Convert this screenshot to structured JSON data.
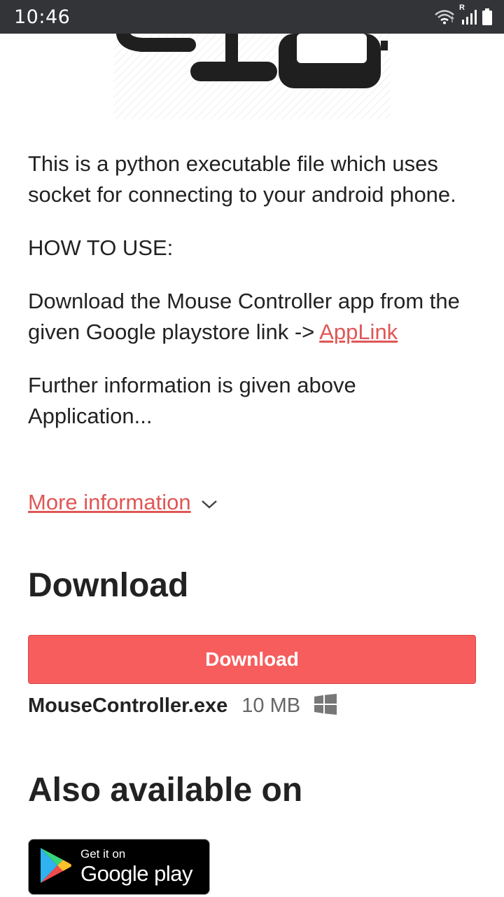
{
  "status_bar": {
    "time": "10:46",
    "roaming_indicator": "R",
    "icons": [
      "wifi-icon",
      "signal-icon",
      "battery-icon"
    ]
  },
  "hero": {
    "icon": "mouse-controller-logo"
  },
  "description": {
    "line1": "This is a python executable file which uses socket for connecting to your android phone.",
    "how_to_use": "HOW TO USE:",
    "download_text": "Download the Mouse Controller app from the given Google playstore link -> ",
    "app_link": "AppLink",
    "further_info": "Further information is given above Application..."
  },
  "more_information": {
    "label": "More information",
    "icon": "chevron-down-icon"
  },
  "download_section": {
    "heading": "Download",
    "button_label": "Download",
    "file_name": "MouseController.exe",
    "file_size": "10 MB",
    "platform_icon": "windows-icon"
  },
  "also_available": {
    "heading": "Also available on",
    "badge_small": "Get it on",
    "badge_big": "Google play"
  },
  "colors": {
    "accent_link": "#e05656",
    "download_button": "#f75d5d",
    "status_bar": "#323437"
  }
}
